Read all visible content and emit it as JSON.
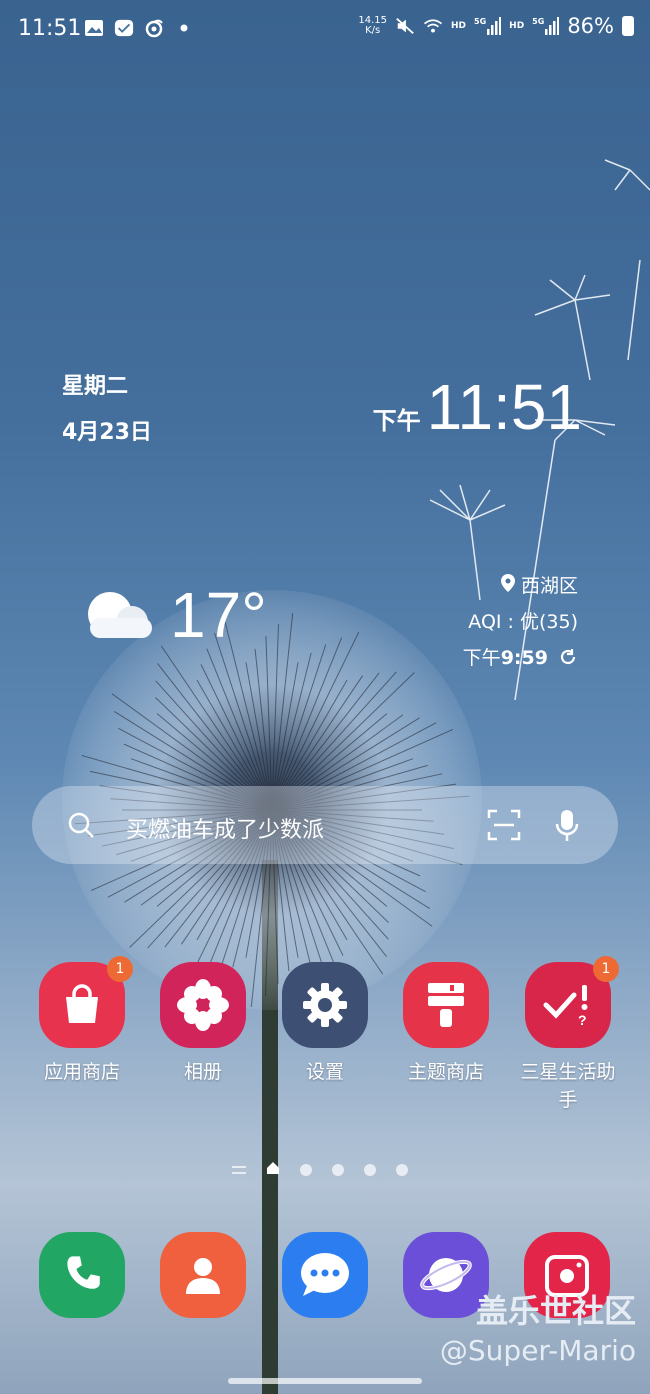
{
  "status_bar": {
    "time": "11:51",
    "net_speed_top": "14.15",
    "net_speed_bottom": "K/s",
    "hd1": "HD",
    "sim1": "5G",
    "hd2": "HD",
    "sim2": "5G",
    "battery": "86%",
    "icons": [
      "gallery-icon",
      "check-app-icon",
      "swirl-icon",
      "dot-icon",
      "mute-icon",
      "wifi-icon",
      "signal-icon",
      "battery-icon"
    ]
  },
  "clock_widget": {
    "weekday": "星期二",
    "date": "4月23日",
    "ampm": "下午",
    "time": "11:51"
  },
  "weather": {
    "temperature": "17°",
    "location": "西湖区",
    "aqi": "AQI : 优(35)",
    "updated_prefix": "下午",
    "updated_time": "9:59"
  },
  "search": {
    "placeholder": "买燃油车成了少数派"
  },
  "apps": [
    {
      "label": "应用商店",
      "badge": "1",
      "color": "#e8334f"
    },
    {
      "label": "相册",
      "badge": "",
      "color": "#d0245a"
    },
    {
      "label": "设置",
      "badge": "",
      "color": "#3d4f72"
    },
    {
      "label": "主题商店",
      "badge": "",
      "color": "#e5334a"
    },
    {
      "label": "三星生活助手",
      "badge": "1",
      "color": "#d8264a"
    }
  ],
  "dock": [
    {
      "name": "phone",
      "color": "#22a663"
    },
    {
      "name": "contacts",
      "color": "#f0603e"
    },
    {
      "name": "messages",
      "color": "#2c7ef0"
    },
    {
      "name": "internet",
      "color": "#6b4fd8"
    },
    {
      "name": "camera",
      "color": "#e3254a"
    }
  ],
  "watermark": {
    "title": "盖乐世社区",
    "handle": "@Super-Mario"
  }
}
